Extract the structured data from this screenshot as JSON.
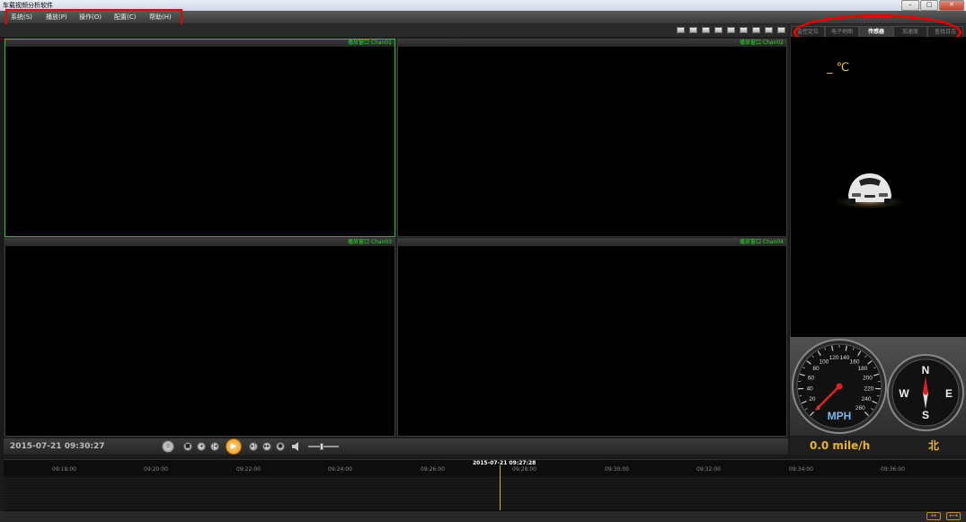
{
  "window": {
    "title": "车载视频分析软件"
  },
  "menu": [
    "系统(S)",
    "播放(P)",
    "操作(O)",
    "配置(C)",
    "帮助(H)"
  ],
  "videos": [
    {
      "label": "播放窗口 Chan01",
      "active": true
    },
    {
      "label": "播放窗口 Chan02",
      "active": false
    },
    {
      "label": "播放窗口 Chan03",
      "active": false
    },
    {
      "label": "播放窗口 Chan04",
      "active": false
    }
  ],
  "playback": {
    "datetime": "2015-07-21 09:30:27",
    "volume_fraction": 0.35
  },
  "right_tabs": [
    {
      "label": "监控定位",
      "active": false
    },
    {
      "label": "电子地图",
      "active": false
    },
    {
      "label": "传感器",
      "active": true
    },
    {
      "label": "加速度",
      "active": false
    },
    {
      "label": "查找日志",
      "active": false
    }
  ],
  "sensor": {
    "temperature": "_ ℃"
  },
  "speedometer": {
    "unit": "MPH",
    "ticks": [
      "0",
      "20",
      "40",
      "60",
      "80",
      "100",
      "120",
      "140",
      "160",
      "180",
      "200",
      "220",
      "240",
      "260"
    ],
    "value": 0
  },
  "compass": {
    "n": "N",
    "e": "E",
    "s": "S",
    "w": "W"
  },
  "status": {
    "speed": "0.0 mile/h",
    "direction": "北"
  },
  "timeline": {
    "cursor_label": "2015-07-21 09:27:28",
    "ticks": [
      "09:18:00",
      "09:20:00",
      "09:22:00",
      "09:24:00",
      "09:26:00",
      "09:28:00",
      "09:30:00",
      "09:32:00",
      "09:34:00",
      "09:36:00"
    ]
  },
  "colors": {
    "accent": "#e8b422",
    "active_border": "#2ec22e",
    "label_green": "#22dd22"
  },
  "icons": {
    "car": "car-icon",
    "play": "play-icon",
    "volume": "speaker-icon"
  }
}
